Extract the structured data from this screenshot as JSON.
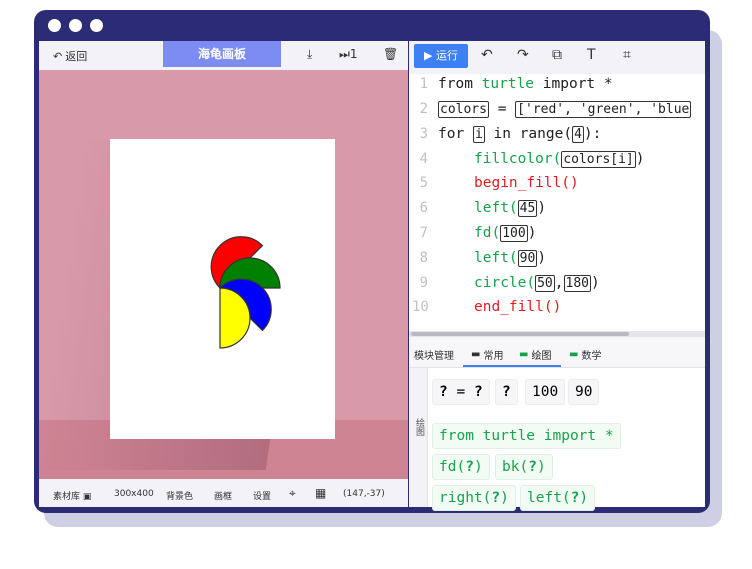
{
  "colors": {
    "frame": "#2b2b76",
    "accent": "#3d7ff5",
    "title_tab": "#7c8cf3",
    "canvas_bg": "#d89aa8",
    "code_green": "#16a34a",
    "code_red": "#e11d1d"
  },
  "left_toolbar": {
    "back_label": "返回",
    "title": "海龟画板",
    "download_icon": "download-icon",
    "step_label": "1",
    "delete_icon": "trash-icon"
  },
  "right_toolbar": {
    "run_label": "运行",
    "icons": [
      "undo-icon",
      "redo-icon",
      "copy-icon",
      "font-size-icon",
      "layout-icon"
    ]
  },
  "code": {
    "lines": [
      "1",
      "2",
      "3",
      "4",
      "5",
      "6",
      "7",
      "8",
      "9",
      "10"
    ],
    "l1": {
      "a": "from",
      "b": "turtle",
      "c": "import *"
    },
    "l2": {
      "var": "colors",
      "eq": "=",
      "list": "['red', 'green', 'blue"
    },
    "l3": {
      "for": "for",
      "i": "i",
      "in": "in range(",
      "n": "4",
      "end": "):"
    },
    "l4": {
      "fn": "fillcolor(",
      "arg": "colors[i]",
      "end": ")"
    },
    "l5": {
      "fn": "begin_fill()"
    },
    "l6": {
      "fn": "left(",
      "arg": "45",
      "end": ")"
    },
    "l7": {
      "fn": "fd(",
      "arg": "100",
      "end": ")"
    },
    "l8": {
      "fn": "left(",
      "arg": "90",
      "end": ")"
    },
    "l9": {
      "fn": "circle(",
      "a1": "50",
      "sep": ",",
      "a2": "180",
      "end": ")"
    },
    "l10": {
      "fn": "end_fill()"
    }
  },
  "bottom_bar": {
    "library": "素材库",
    "size": "300x400",
    "bg_color": "背景色",
    "frame": "画框",
    "settings": "设置",
    "coords": "(147,-37)"
  },
  "block_tabs": {
    "modules": "模块管理",
    "common": "常用",
    "draw": "绘图",
    "math": "数学",
    "side": "绘图"
  },
  "blocks": {
    "assign_q": "?",
    "assign_eq": "=",
    "assign_q2": "?",
    "q3": "?",
    "n100": "100",
    "n90": "90",
    "import": "from turtle import *",
    "fd": "fd(",
    "bk": "bk(",
    "right": "right(",
    "left": "left(",
    "qm": "?",
    "close": ")"
  },
  "pinwheel": {
    "blade_colors": [
      "red",
      "green",
      "blue",
      "yellow"
    ],
    "radius_units": 50
  }
}
